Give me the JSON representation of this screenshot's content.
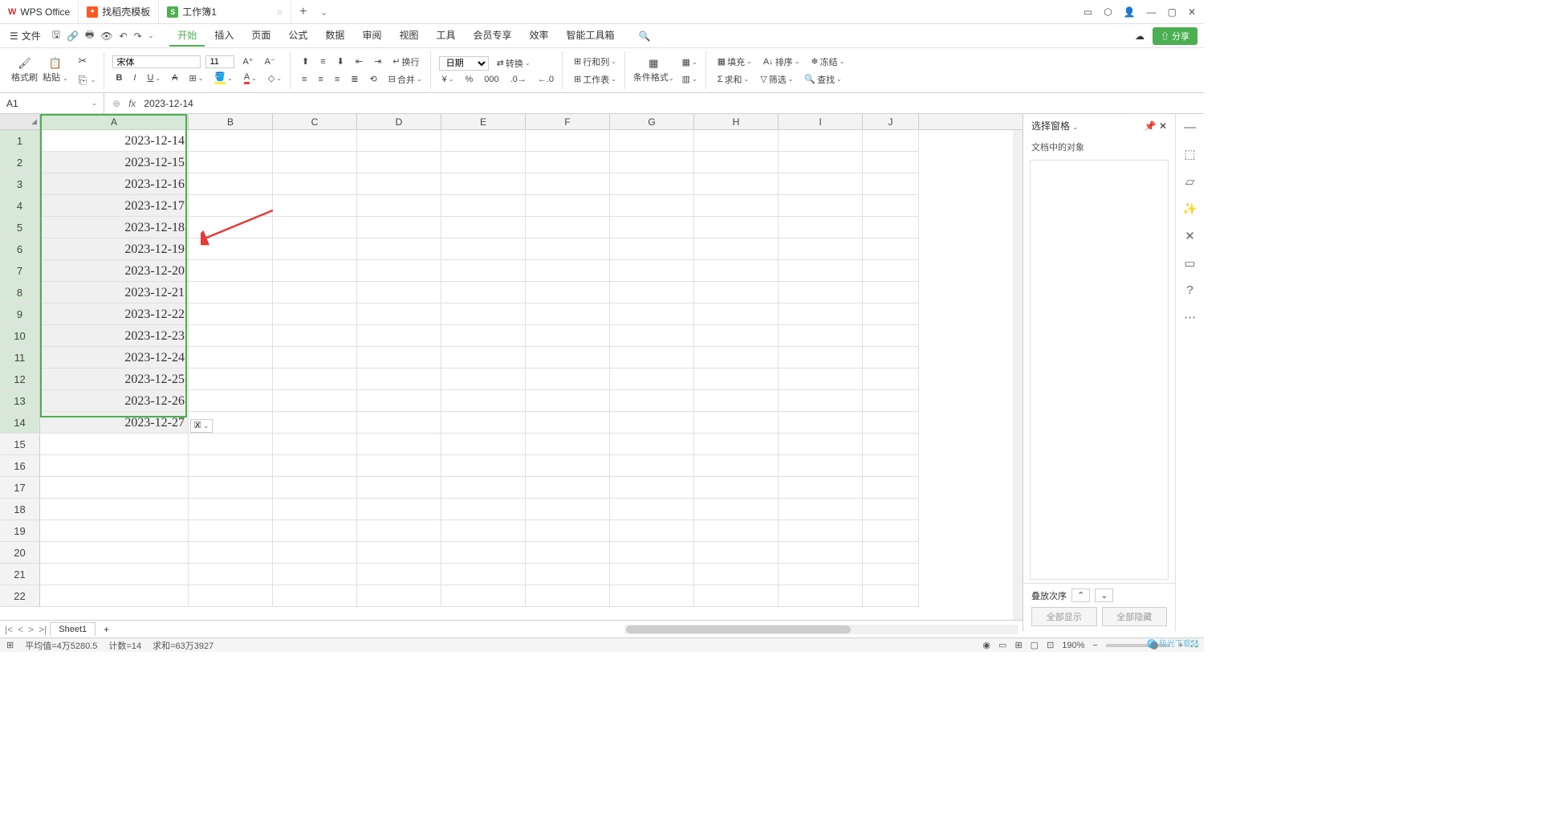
{
  "titlebar": {
    "tabs": [
      {
        "icon": "W",
        "label": "WPS Office"
      },
      {
        "icon": "D",
        "label": "找稻壳模板"
      },
      {
        "icon": "S",
        "label": "工作簿1"
      }
    ]
  },
  "menu": {
    "file": "文件",
    "tabs": [
      "开始",
      "插入",
      "页面",
      "公式",
      "数据",
      "审阅",
      "视图",
      "工具",
      "会员专享",
      "效率",
      "智能工具箱"
    ],
    "active": "开始",
    "share": "分享"
  },
  "ribbon": {
    "format_painter": "格式刷",
    "paste": "粘贴",
    "font_name": "宋体",
    "font_size": "11",
    "wrap": "换行",
    "merge": "合并",
    "number_format": "日期",
    "convert": "转换",
    "row_col": "行和列",
    "worksheet": "工作表",
    "cond_format": "条件格式",
    "fill": "填充",
    "sort": "排序",
    "freeze": "冻结",
    "sum": "求和",
    "filter": "筛选",
    "find": "查找"
  },
  "formula_bar": {
    "name_box": "A1",
    "formula": "2023-12-14"
  },
  "columns": [
    "A",
    "B",
    "C",
    "D",
    "E",
    "F",
    "G",
    "H",
    "I",
    "J"
  ],
  "rows_visible": 22,
  "selection_rows": 14,
  "cells": {
    "A": [
      "2023-12-14",
      "2023-12-15",
      "2023-12-16",
      "2023-12-17",
      "2023-12-18",
      "2023-12-19",
      "2023-12-20",
      "2023-12-21",
      "2023-12-22",
      "2023-12-23",
      "2023-12-24",
      "2023-12-25",
      "2023-12-26",
      "2023-12-27"
    ]
  },
  "panel": {
    "title": "选择窗格",
    "subtitle": "文档中的对象",
    "stack_order": "叠放次序",
    "show_all": "全部显示",
    "hide_all": "全部隐藏"
  },
  "sheet_tabs": {
    "active": "Sheet1"
  },
  "status": {
    "avg": "平均值=4万5280.5",
    "count": "计数=14",
    "sum": "求和=63万3927",
    "zoom": "190%"
  },
  "watermark": "极光下载站"
}
